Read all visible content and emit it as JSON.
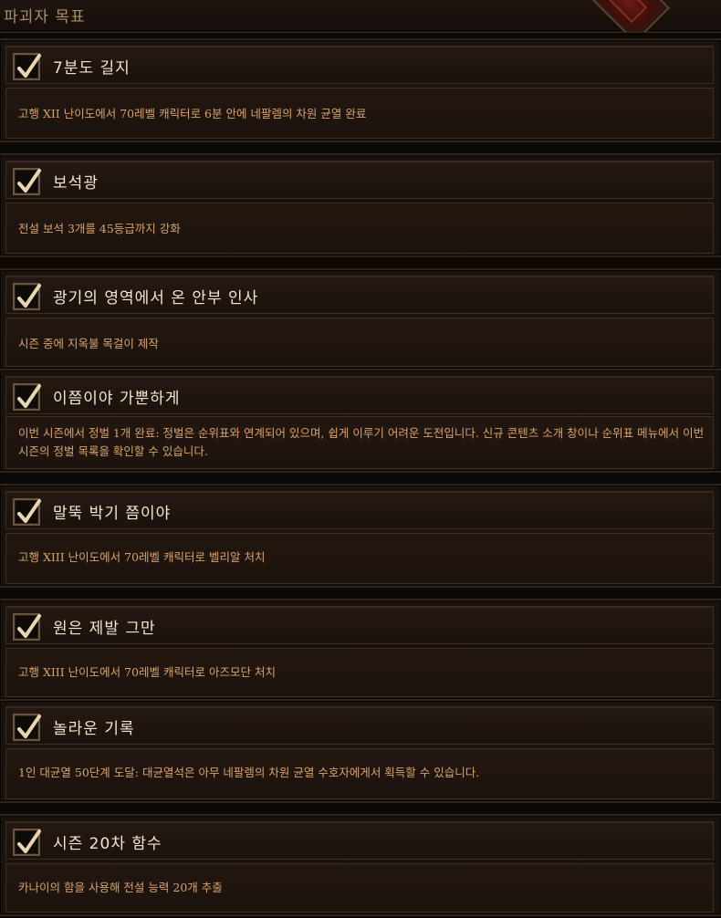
{
  "header": {
    "title": "파괴자 목표"
  },
  "achievements": [
    {
      "title": "7분도 길지",
      "description": "고행 XII 난이도에서 70레벨 캐릭터로 6분 안에 네팔렘의 차원 균열 완료",
      "checked": true
    },
    {
      "title": "보석광",
      "description": "전설 보석 3개를 45등급까지 강화",
      "checked": true
    },
    {
      "title": "광기의 영역에서 온 안부 인사",
      "description": "시즌 중에 지옥불 목걸이 제작",
      "checked": true
    },
    {
      "title": "이쯤이야 가뿐하게",
      "description": "이번 시즌에서 정벌 1개 완료: 정벌은 순위표와 연계되어 있으며, 쉽게 이루기 어려운 도전입니다. 신규 콘텐츠 소개 창이나 순위표 메뉴에서 이번 시즌의 정벌 목록을 확인할 수 있습니다.",
      "checked": true
    },
    {
      "title": "말뚝 박기 쯤이야",
      "description": "고행 XIII 난이도에서 70레벨 캐릭터로 벨리알 처치",
      "checked": true
    },
    {
      "title": "원은 제발 그만",
      "description": "고행 XIII 난이도에서 70레벨 캐릭터로 아즈모단 처치",
      "checked": true
    },
    {
      "title": "놀라운 기록",
      "description": "1인 대균열 50단계 도달: 대균열석은 아무 네팔렘의 차원 균열 수호자에게서 획득할 수 있습니다.",
      "checked": true
    },
    {
      "title": "시즌 20차 함수",
      "description": "카나이의 함을 사용해 전설 능력 20개 추출",
      "checked": true
    }
  ],
  "colors": {
    "title": "#f0e6d2",
    "description": "#d8a36c",
    "check": "#e8d6b0"
  }
}
